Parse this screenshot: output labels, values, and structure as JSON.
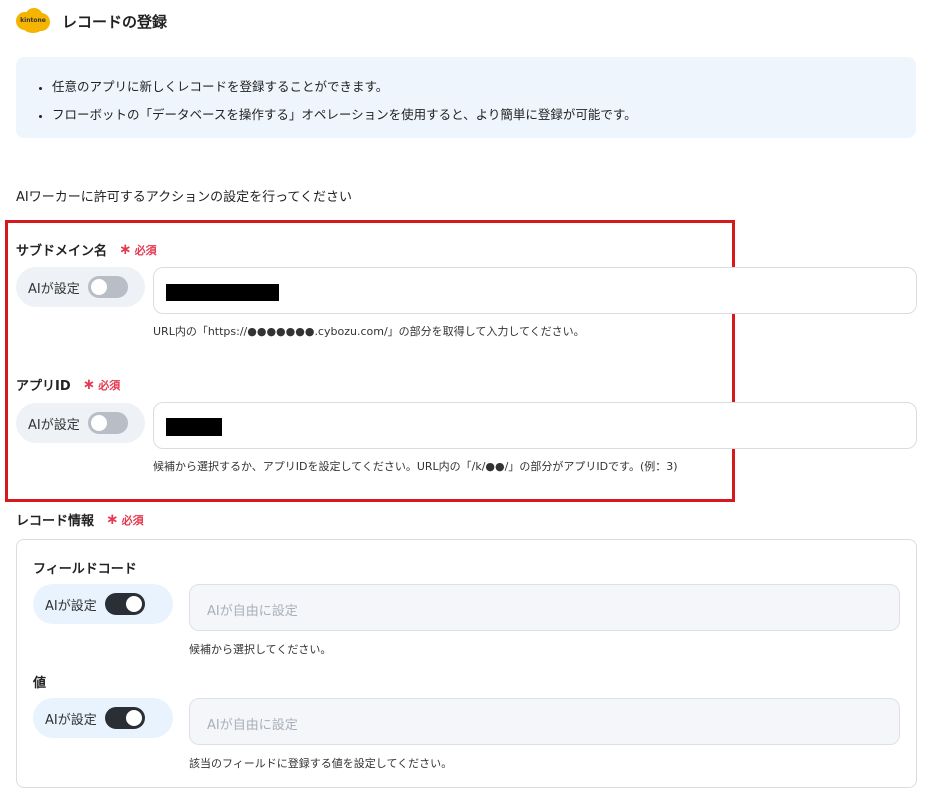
{
  "header": {
    "logo_text": "kintone",
    "title": "レコードの登録"
  },
  "info": {
    "bullets": [
      "任意のアプリに新しくレコードを登録することができます。",
      "フローボットの「データベースを操作する」オペレーションを使用すると、より簡単に登録が可能です。"
    ]
  },
  "intro": "AIワーカーに許可するアクションの設定を行ってください",
  "required_label": "必須",
  "ai_toggle_label": "AIが設定",
  "subdomain": {
    "label": "サブドメイン名",
    "ai_enabled": false,
    "help": "URL内の「https://●●●●●●●.cybozu.com/」の部分を取得して入力してください。"
  },
  "app_id": {
    "label": "アプリID",
    "ai_enabled": false,
    "help": "候補から選択するか、アプリIDを設定してください。URL内の「/k/●●/」の部分がアプリIDです。(例：3)"
  },
  "record_info": {
    "label": "レコード情報",
    "field_code": {
      "label": "フィールドコード",
      "ai_enabled": true,
      "placeholder": "AIが自由に設定",
      "help": "候補から選択してください。"
    },
    "value": {
      "label": "値",
      "ai_enabled": true,
      "placeholder": "AIが自由に設定",
      "help": "該当のフィールドに登録する値を設定してください。"
    }
  },
  "colors": {
    "required": "#e53950",
    "highlight_border": "#d7191c",
    "info_bg": "#eef5fd",
    "logo": "#f4b400"
  }
}
